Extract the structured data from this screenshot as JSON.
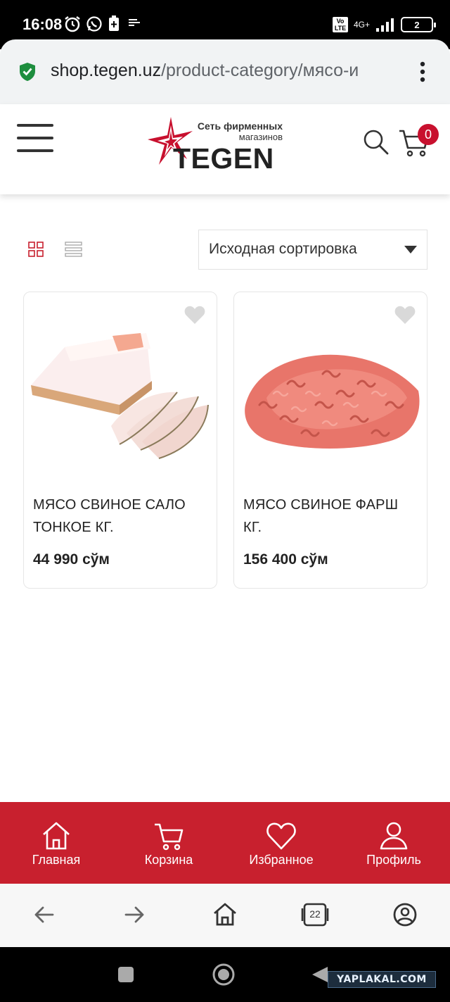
{
  "status_bar": {
    "time": "16:08",
    "network": "4G+",
    "volte": "Vo LTE",
    "battery": "2"
  },
  "browser": {
    "url_host": "shop.tegen.uz",
    "url_path": "/product-category/мясо-и",
    "tab_count": "22"
  },
  "header": {
    "logo_tagline_1": "Сеть фирменных",
    "logo_tagline_2": "магазинов",
    "logo_name": "TEGEN",
    "cart_count": "0",
    "brand_color": "#c8202e"
  },
  "toolbar": {
    "sort_selected": "Исходная сортировка"
  },
  "products": [
    {
      "name_line1": "МЯСО СВИНОЕ САЛО",
      "name_line2": "ТОНКОЕ КГ.",
      "price": "44 990 сўм",
      "image": "pork-fat-image"
    },
    {
      "name_line1": "МЯСО СВИНОЕ ФАРШ",
      "name_line2": "КГ.",
      "price": "156 400 сўм",
      "image": "minced-pork-image"
    }
  ],
  "bottom_nav": [
    {
      "label": "Главная",
      "icon": "home-icon"
    },
    {
      "label": "Корзина",
      "icon": "cart-icon"
    },
    {
      "label": "Избранное",
      "icon": "heart-icon"
    },
    {
      "label": "Профиль",
      "icon": "user-icon"
    }
  ],
  "watermark": "YAPLAKAL.COM"
}
